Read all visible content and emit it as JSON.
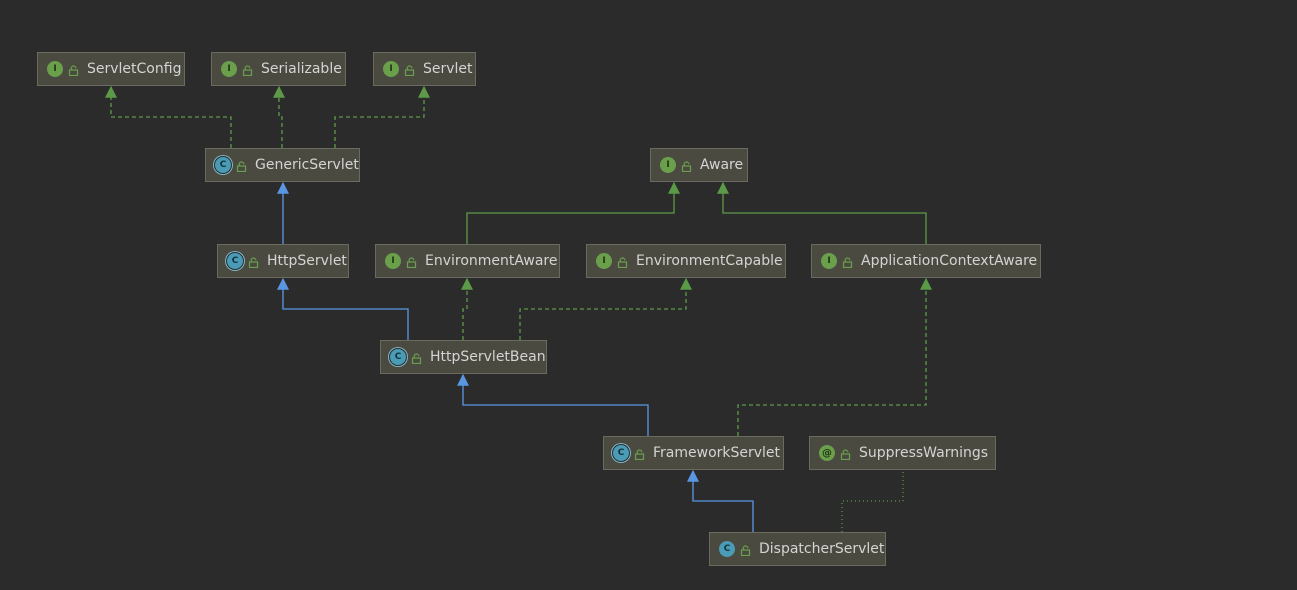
{
  "diagram": {
    "nodes": [
      {
        "id": "ServletConfig",
        "label": "ServletConfig",
        "kind": "interface",
        "badge": "I"
      },
      {
        "id": "Serializable",
        "label": "Serializable",
        "kind": "interface",
        "badge": "I"
      },
      {
        "id": "Servlet",
        "label": "Servlet",
        "kind": "interface",
        "badge": "I"
      },
      {
        "id": "GenericServlet",
        "label": "GenericServlet",
        "kind": "abstract",
        "badge": "C"
      },
      {
        "id": "Aware",
        "label": "Aware",
        "kind": "interface",
        "badge": "I"
      },
      {
        "id": "HttpServlet",
        "label": "HttpServlet",
        "kind": "abstract",
        "badge": "C"
      },
      {
        "id": "EnvironmentAware",
        "label": "EnvironmentAware",
        "kind": "interface",
        "badge": "I"
      },
      {
        "id": "EnvironmentCapable",
        "label": "EnvironmentCapable",
        "kind": "interface",
        "badge": "I"
      },
      {
        "id": "ApplicationContextAware",
        "label": "ApplicationContextAware",
        "kind": "interface",
        "badge": "I"
      },
      {
        "id": "HttpServletBean",
        "label": "HttpServletBean",
        "kind": "abstract",
        "badge": "C"
      },
      {
        "id": "FrameworkServlet",
        "label": "FrameworkServlet",
        "kind": "abstract",
        "badge": "C"
      },
      {
        "id": "SuppressWarnings",
        "label": "SuppressWarnings",
        "kind": "annotation",
        "badge": "@"
      },
      {
        "id": "DispatcherServlet",
        "label": "DispatcherServlet",
        "kind": "class",
        "badge": "C"
      }
    ],
    "edges": [
      {
        "from": "GenericServlet",
        "to": "ServletConfig",
        "type": "implements"
      },
      {
        "from": "GenericServlet",
        "to": "Serializable",
        "type": "implements"
      },
      {
        "from": "GenericServlet",
        "to": "Servlet",
        "type": "implements"
      },
      {
        "from": "HttpServlet",
        "to": "GenericServlet",
        "type": "extends"
      },
      {
        "from": "EnvironmentAware",
        "to": "Aware",
        "type": "interface-extends"
      },
      {
        "from": "ApplicationContextAware",
        "to": "Aware",
        "type": "interface-extends"
      },
      {
        "from": "HttpServletBean",
        "to": "HttpServlet",
        "type": "extends"
      },
      {
        "from": "HttpServletBean",
        "to": "EnvironmentAware",
        "type": "implements"
      },
      {
        "from": "HttpServletBean",
        "to": "EnvironmentCapable",
        "type": "implements"
      },
      {
        "from": "FrameworkServlet",
        "to": "HttpServletBean",
        "type": "extends"
      },
      {
        "from": "FrameworkServlet",
        "to": "ApplicationContextAware",
        "type": "implements"
      },
      {
        "from": "DispatcherServlet",
        "to": "FrameworkServlet",
        "type": "extends"
      },
      {
        "from": "DispatcherServlet",
        "to": "SuppressWarnings",
        "type": "annotated"
      }
    ],
    "colors": {
      "background": "#2b2b2b",
      "node_fill": "#4b4a41",
      "node_border": "#6b6a5f",
      "extends_line": "#5a97e2",
      "implements_line": "#5c9a48",
      "annotation_line": "#5c9a48",
      "interface_badge": "#6a9f4c",
      "class_badge": "#4a9bb5",
      "lock_icon": "#6a9f4c"
    }
  }
}
